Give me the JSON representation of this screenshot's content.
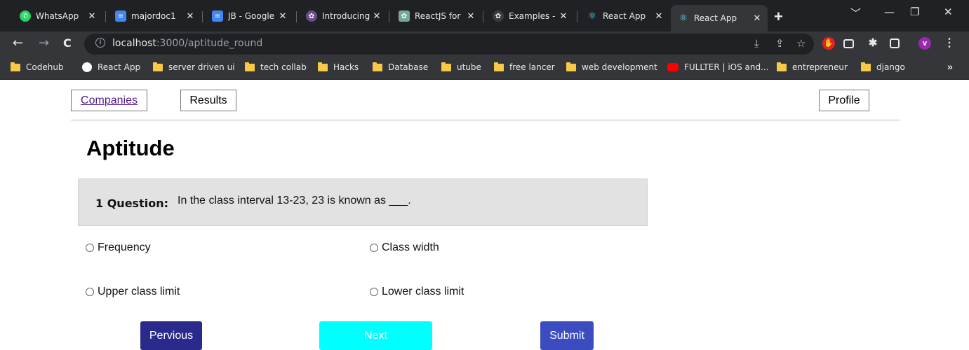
{
  "browser": {
    "tabs": [
      {
        "label": "WhatsApp",
        "icon": "whatsapp-icon",
        "color": "#25d366"
      },
      {
        "label": "majordoc1",
        "icon": "docs-icon",
        "color": "#4285f4"
      },
      {
        "label": "JB - Google",
        "icon": "docs-icon",
        "color": "#4285f4"
      },
      {
        "label": "Introducing",
        "icon": "openai-icon",
        "color": "#c7a2f2"
      },
      {
        "label": "ReactJS for",
        "icon": "chatgpt-icon",
        "color": "#74aa9c"
      },
      {
        "label": "Examples -",
        "icon": "openai-icon",
        "color": "#3c3c3c"
      },
      {
        "label": "React App",
        "icon": "react-icon",
        "color": "#61dafb"
      },
      {
        "label": "React App",
        "icon": "react-icon",
        "color": "#61dafb"
      }
    ],
    "new_tab": "+",
    "window_controls": {
      "dropdown": "﹀",
      "minimize": "—",
      "restore": "❐",
      "close": "✕"
    },
    "nav": {
      "back": "←",
      "forward": "→",
      "reload": "C"
    },
    "url": {
      "host": "localhost",
      "path": ":3000/aptitude_round"
    },
    "ext_avatar": "v",
    "bookmarks": [
      {
        "label": "Codehub",
        "type": "folder"
      },
      {
        "label": "React App",
        "type": "site"
      },
      {
        "label": "server driven ui",
        "type": "folder"
      },
      {
        "label": "tech collab",
        "type": "folder"
      },
      {
        "label": "Hacks",
        "type": "folder"
      },
      {
        "label": "Database",
        "type": "folder"
      },
      {
        "label": "utube",
        "type": "folder"
      },
      {
        "label": "free lancer",
        "type": "folder"
      },
      {
        "label": "web development",
        "type": "folder"
      },
      {
        "label": "FULLTER | iOS and...",
        "type": "youtube"
      },
      {
        "label": "entrepreneur",
        "type": "folder"
      },
      {
        "label": "django",
        "type": "folder"
      }
    ],
    "bookmarks_more": "»"
  },
  "nav": {
    "companies": "Companies",
    "results": "Results",
    "profile": "Profile"
  },
  "page_title": "Aptitude",
  "question": {
    "label": "1 Question:",
    "text": "In the class interval 13-23, 23 is known as ___."
  },
  "options": [
    "Frequency",
    "Class width",
    "Upper class limit",
    "Lower class limit"
  ],
  "buttons": {
    "previous": "Pervious",
    "next": "Next",
    "submit": "Submit"
  }
}
